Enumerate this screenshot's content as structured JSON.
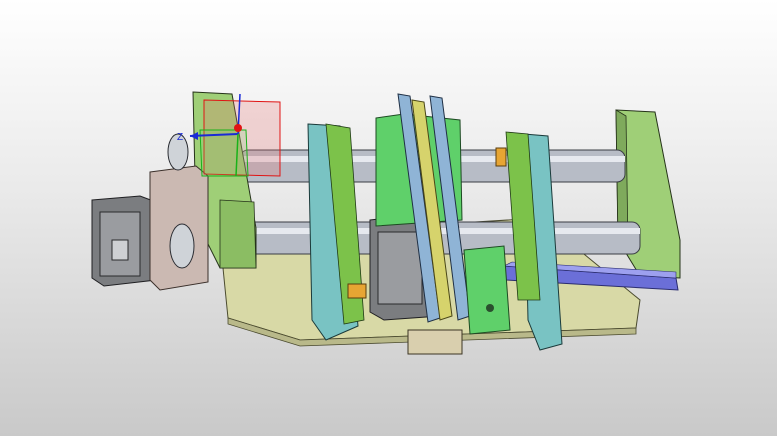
{
  "viewport": {
    "background_top": "#ffffff",
    "background_bottom": "#c9c9c9"
  },
  "triad": {
    "z_axis_label": "Z",
    "x_axis_color": "#e01414",
    "y_axis_color": "#19b219",
    "z_axis_color": "#1a2bd6"
  },
  "model": {
    "colors": {
      "frame_green": "#9fcf77",
      "plate_teal": "#79c3c3",
      "plate_blue": "#8fb4d6",
      "rod_gray": "#b7bcc6",
      "motor_gray": "#7b7d80",
      "base_beige": "#d8d9a6",
      "bracket_orange": "#e7a533",
      "rail_purple": "#6b6fd8"
    }
  }
}
